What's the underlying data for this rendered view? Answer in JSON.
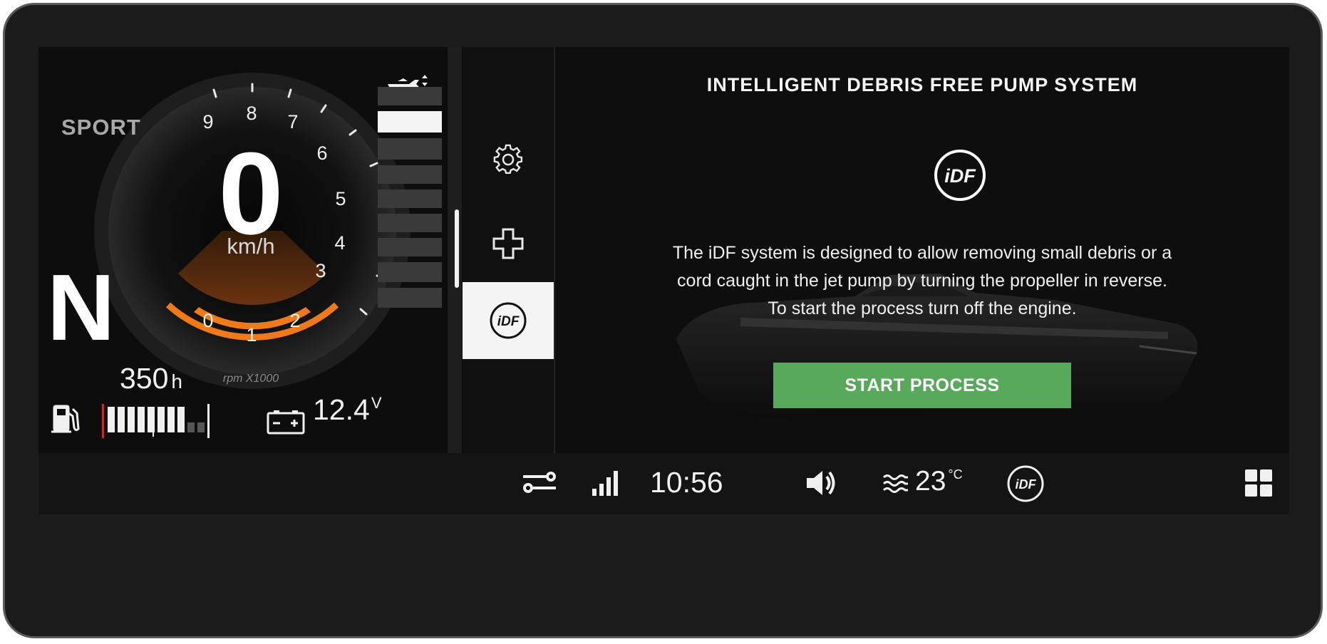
{
  "cluster": {
    "mode": "SPORT",
    "gear": "N",
    "speed": "0",
    "speed_unit": "km/h",
    "rpm_label": "rpm X1000",
    "rpm_ticks": [
      "0",
      "1",
      "2",
      "3",
      "4",
      "5",
      "6",
      "7",
      "8",
      "9"
    ],
    "engine_hours": "350",
    "hours_unit": "h",
    "fuel_level_fraction": 0.8,
    "battery_voltage": "12.4",
    "voltage_unit": "V",
    "trim_icon": "watercraft-trim-icon"
  },
  "menu": {
    "items": [
      {
        "name": "settings",
        "icon": "gear-icon"
      },
      {
        "name": "maintenance",
        "icon": "plus-cross-icon"
      },
      {
        "name": "idf",
        "icon": "idf-icon",
        "label": "iDF",
        "active": true
      }
    ]
  },
  "main": {
    "title": "INTELLIGENT DEBRIS FREE PUMP SYSTEM",
    "badge": "iDF",
    "description": [
      "The iDF system is designed to allow removing small debris or a",
      "cord caught in the jet pump by turning the propeller in reverse.",
      "To start the process turn off the engine."
    ],
    "button_label": "START PROCESS"
  },
  "statusbar": {
    "time": "10:56",
    "water_temp": "23",
    "temp_unit": "°C",
    "idf_label": "iDF"
  },
  "colors": {
    "accent_orange": "#f07a1a",
    "button_green": "#58a95b"
  }
}
